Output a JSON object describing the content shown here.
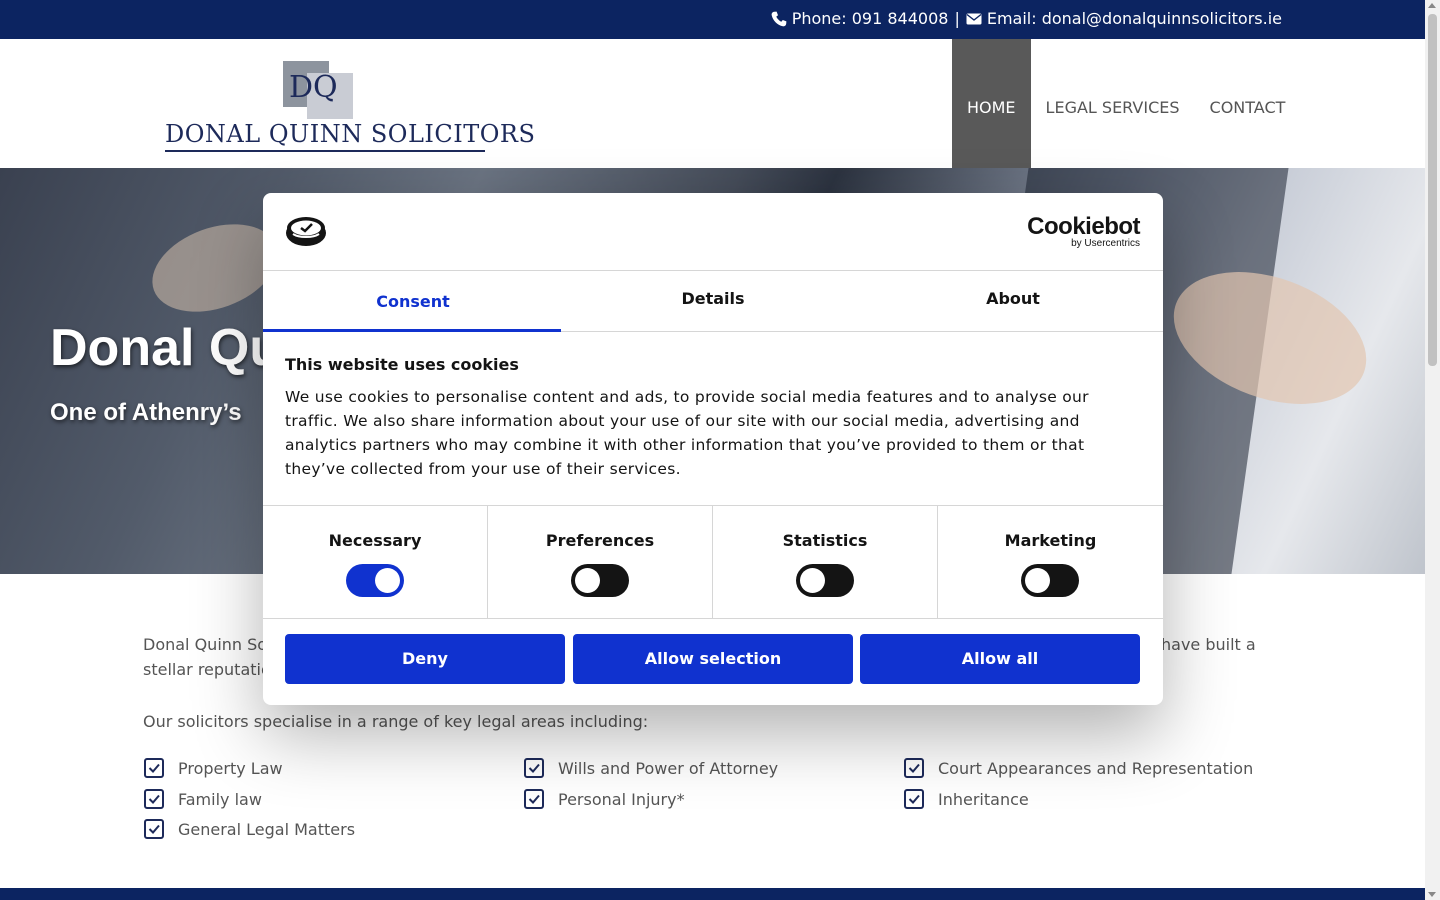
{
  "topbar": {
    "phone": "Phone: 091 844008",
    "separator": "|",
    "email": "Email: donal@donalquinnsolicitors.ie"
  },
  "header": {
    "logo_monogram": "DQ",
    "logo_text": "DONAL QUINN SOLICITORS",
    "nav": [
      {
        "label": "HOME",
        "active": true
      },
      {
        "label": "LEGAL SERVICES",
        "active": false
      },
      {
        "label": "CONTACT",
        "active": false
      }
    ]
  },
  "hero": {
    "title": "Donal Qu",
    "subtitle": "One of Athenry’s"
  },
  "content": {
    "intro_start": "Donal Quinn Sol",
    "intro_end": "have built a",
    "intro_line2": "stellar reputatio",
    "lead": "Our solicitors specialise in a range of key legal areas including:",
    "areas": [
      "Property Law",
      "Wills and Power of Attorney",
      "Court Appearances and Representation",
      "Family law",
      "Personal Injury*",
      "Inheritance",
      "General Legal Matters"
    ]
  },
  "cookie_dialog": {
    "brand": "Cookiebot",
    "brand_sub": "by Usercentrics",
    "tabs": [
      {
        "label": "Consent",
        "active": true
      },
      {
        "label": "Details",
        "active": false
      },
      {
        "label": "About",
        "active": false
      }
    ],
    "heading": "This website uses cookies",
    "body": "We use cookies to personalise content and ads, to provide social media features and to analyse our traffic. We also share information about your use of our site with our social media, advertising and analytics partners who may combine it with other information that you’ve provided to them or that they’ve collected from your use of their services.",
    "toggles": [
      {
        "label": "Necessary",
        "on": true
      },
      {
        "label": "Preferences",
        "on": false
      },
      {
        "label": "Statistics",
        "on": false
      },
      {
        "label": "Marketing",
        "on": false
      }
    ],
    "buttons": {
      "deny": "Deny",
      "allow_selection": "Allow selection",
      "allow_all": "Allow all"
    }
  },
  "colors": {
    "navy": "#0c2461",
    "accent_blue": "#1032cf",
    "nav_active_bg": "#595959"
  },
  "icons": [
    "phone-icon",
    "envelope-icon",
    "checkbox-checked-icon",
    "cookiebot-logo-icon"
  ]
}
